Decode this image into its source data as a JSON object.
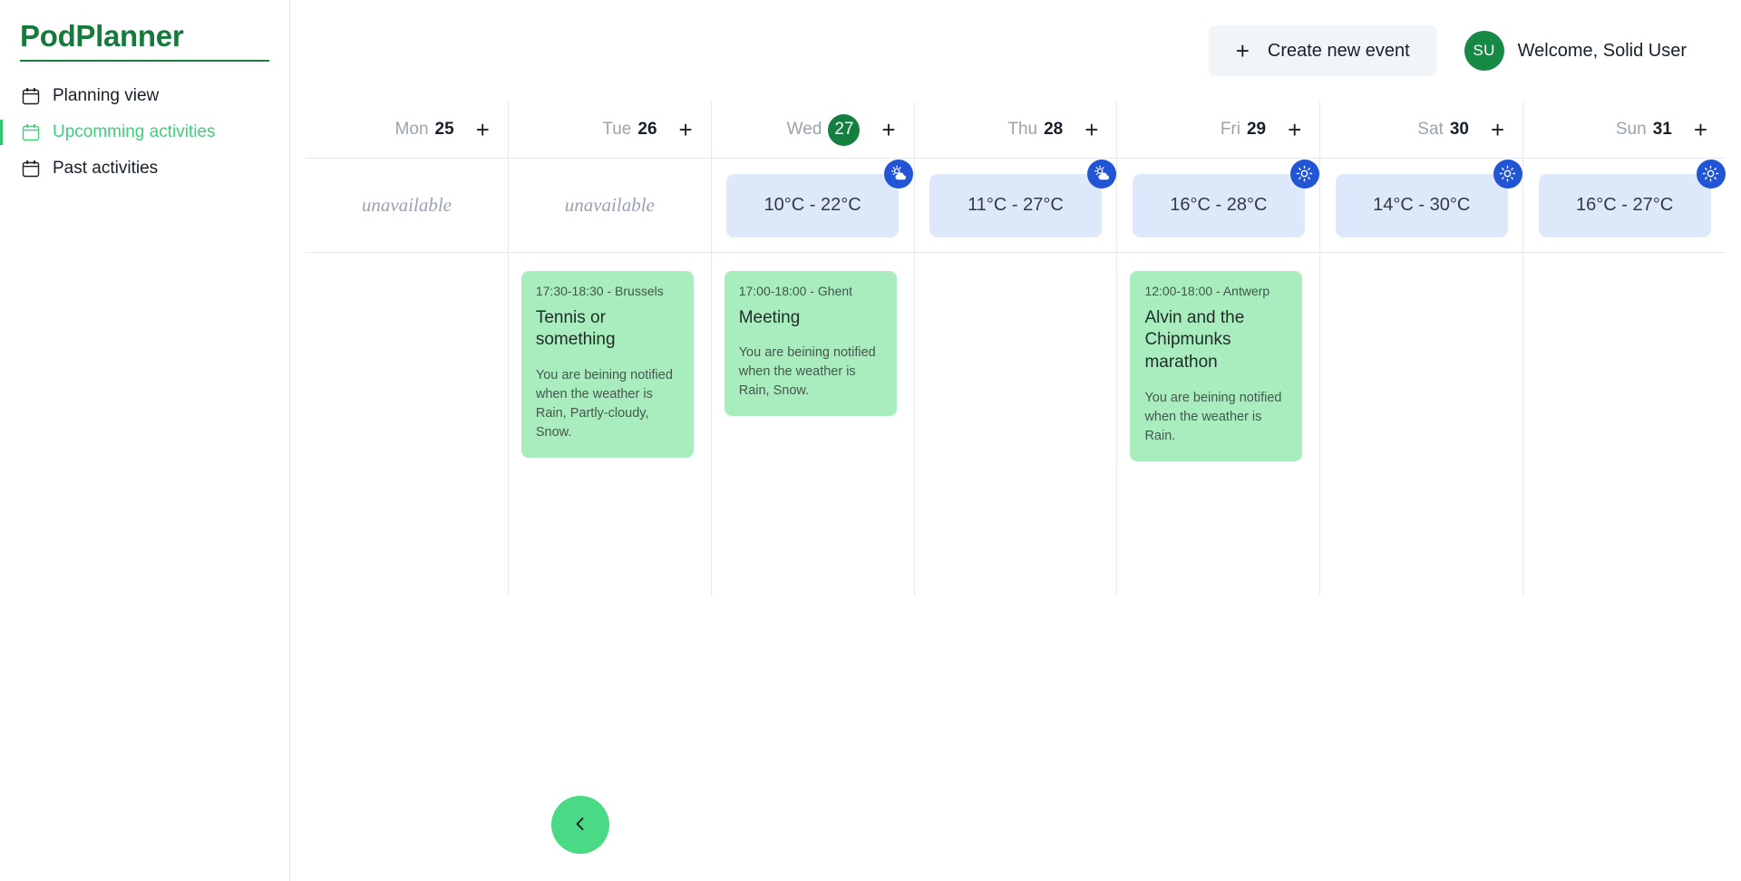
{
  "brand": {
    "name": "PodPlanner"
  },
  "sidebar": {
    "items": [
      {
        "label": "Planning view",
        "icon": "calendar-icon",
        "active": false
      },
      {
        "label": "Upcomming activities",
        "icon": "calendar-icon",
        "active": true
      },
      {
        "label": "Past activities",
        "icon": "calendar-icon",
        "active": false
      }
    ]
  },
  "topbar": {
    "create_label": "Create new event",
    "create_icon": "plus-icon",
    "avatar_initials": "SU",
    "welcome": "Welcome, Solid User"
  },
  "calendar": {
    "add_icon": "plus-icon",
    "unavailable_label": "unavailable",
    "days": [
      {
        "name": "Mon",
        "num": "25",
        "today": false,
        "weather": null,
        "icon": null,
        "events": []
      },
      {
        "name": "Tue",
        "num": "26",
        "today": false,
        "weather": null,
        "icon": null,
        "events": [
          {
            "meta": "17:30-18:30 - Brussels",
            "title": "Tennis or something",
            "desc": "You are beining notified when the weather is Rain, Partly-cloudy, Snow."
          }
        ]
      },
      {
        "name": "Wed",
        "num": "27",
        "today": true,
        "weather": "10°C  -  22°C",
        "icon": "partly-cloudy-icon",
        "events": [
          {
            "meta": "17:00-18:00 - Ghent",
            "title": "Meeting",
            "desc": "You are beining notified when the weather is Rain, Snow."
          }
        ]
      },
      {
        "name": "Thu",
        "num": "28",
        "today": false,
        "weather": "11°C  -  27°C",
        "icon": "partly-cloudy-icon",
        "events": []
      },
      {
        "name": "Fri",
        "num": "29",
        "today": false,
        "weather": "16°C  -  28°C",
        "icon": "sun-icon",
        "events": [
          {
            "meta": "12:00-18:00 - Antwerp",
            "title": "Alvin and the Chipmunks marathon",
            "desc": "You are beining notified when the weather is Rain."
          }
        ]
      },
      {
        "name": "Sat",
        "num": "30",
        "today": false,
        "weather": "14°C  -  30°C",
        "icon": "sun-icon",
        "events": []
      },
      {
        "name": "Sun",
        "num": "31",
        "today": false,
        "weather": "16°C  -  27°C",
        "icon": "sun-icon",
        "events": []
      }
    ]
  },
  "fab": {
    "icon": "chevron-left-icon"
  },
  "colors": {
    "brand_green": "#157a3c",
    "active_green": "#3fd07a",
    "today_badge": "#13803f",
    "weather_bg": "#dde8fb",
    "weather_badge": "#2255d6",
    "event_bg": "#a9edbf",
    "fab_green": "#4ad985"
  }
}
